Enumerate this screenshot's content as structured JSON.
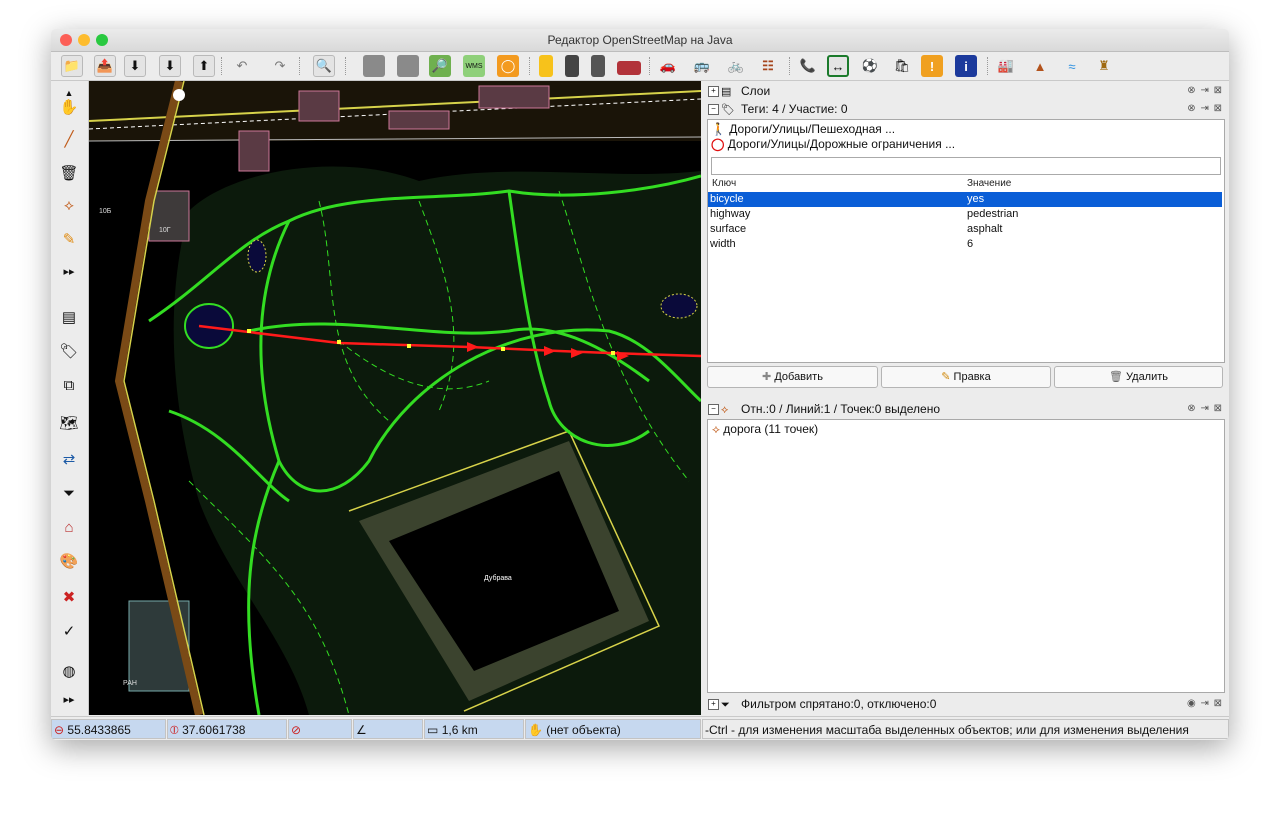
{
  "window": {
    "title": "Редактор OpenStreetMap на Java"
  },
  "toolbar": {
    "buttons": [
      "open-file",
      "open-location",
      "download",
      "download-along",
      "upload",
      "undo",
      "redo",
      "preferences",
      "layer-imagery",
      "layer-wms",
      "search",
      "wms-tms",
      "loop",
      "road-yellow",
      "traffic-light",
      "lights",
      "wall",
      "car",
      "bus",
      "bicycle",
      "railway",
      "phone",
      "road-sign",
      "soccer",
      "shop",
      "warning",
      "info",
      "industrial",
      "peak",
      "waterway",
      "castle"
    ]
  },
  "left_tools": [
    "select-mode",
    "draw-mode",
    "delete-mode",
    "improve-way",
    "draw-pencil",
    "more-tools",
    "layers-toggle",
    "tags-toggle",
    "relations-toggle",
    "download-area",
    "merge",
    "filter",
    "addr",
    "styles",
    "validation",
    "changeset",
    "wiki",
    "more"
  ],
  "map": {
    "label_forest": "Дубрава",
    "label_building_1": "10Б",
    "label_building_2": "10Г",
    "label_ran": "РАН"
  },
  "panels": {
    "layers": {
      "title": "Слои"
    },
    "tags": {
      "title": "Теги: 4 / Участие: 0",
      "presets": [
        "Дороги/Улицы/Пешеходная ...",
        "Дороги/Улицы/Дорожные ограничения ..."
      ],
      "col_key": "Ключ",
      "col_value": "Значение",
      "rows": [
        {
          "key": "bicycle",
          "value": "yes"
        },
        {
          "key": "highway",
          "value": "pedestrian"
        },
        {
          "key": "surface",
          "value": "asphalt"
        },
        {
          "key": "width",
          "value": "6"
        }
      ],
      "btn_add": "Добавить",
      "btn_edit": "Правка",
      "btn_delete": "Удалить"
    },
    "selection": {
      "title": "Отн.:0 / Линий:1 / Точек:0 выделено",
      "items": [
        "дорога (11 точек)"
      ]
    },
    "filter": {
      "title": "Фильтром спрятано:0, отключено:0"
    }
  },
  "status": {
    "lat": "55.8433865",
    "lon": "37.6061738",
    "distance": "1,6 km",
    "object": "(нет объекта)",
    "help": "-Ctrl - для изменения масштаба выделенных объектов; или для изменения выделения"
  },
  "colors": {
    "map_bg": "#000000",
    "path_green": "#33dd22",
    "selected_way": "#ff1a1a",
    "selection_blue": "#0a5ed7",
    "status_blue": "#c6d8ef"
  }
}
